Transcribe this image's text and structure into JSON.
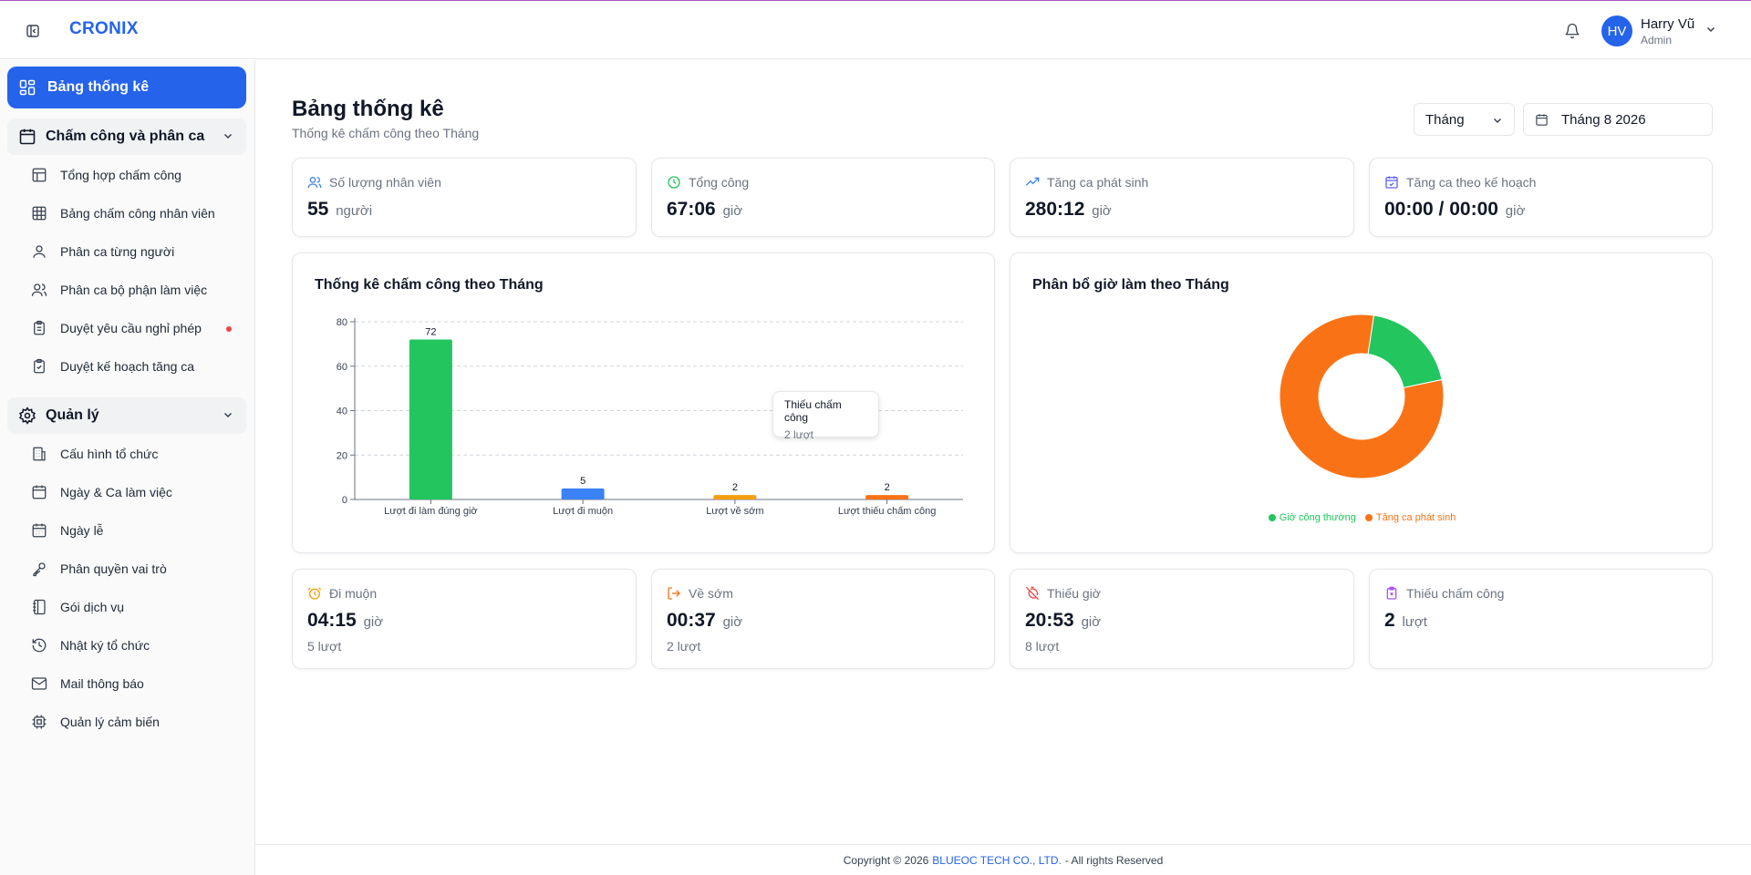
{
  "app": {
    "brand": "CRONIX"
  },
  "user": {
    "initials": "HV",
    "name": "Harry Vũ",
    "role": "Admin"
  },
  "sidebar": {
    "active": {
      "label": "Bảng thống kê"
    },
    "groups": [
      {
        "label": "Chấm công và phân ca",
        "items": [
          {
            "label": "Tổng hợp chấm công"
          },
          {
            "label": "Bảng chấm công nhân viên"
          },
          {
            "label": "Phân ca từng người"
          },
          {
            "label": "Phân ca bộ phận làm việc"
          },
          {
            "label": "Duyệt yêu cầu nghỉ phép",
            "has_notification": true
          },
          {
            "label": "Duyệt kế hoạch tăng ca"
          }
        ]
      },
      {
        "label": "Quản lý",
        "items": [
          {
            "label": "Cấu hình tổ chức"
          },
          {
            "label": "Ngày & Ca làm việc"
          },
          {
            "label": "Ngày lễ"
          },
          {
            "label": "Phân quyền vai trò"
          },
          {
            "label": "Gói dịch vụ"
          },
          {
            "label": "Nhật ký tổ chức"
          },
          {
            "label": "Mail thông báo"
          },
          {
            "label": "Quản lý cảm biến"
          }
        ]
      }
    ]
  },
  "page": {
    "title": "Bảng thống kê",
    "subtitle": "Thống kê chấm công theo Tháng",
    "period_select": "Tháng",
    "date_value": "Tháng 8 2026"
  },
  "stats_top": [
    {
      "label": "Số lượng nhân viên",
      "value": "55",
      "unit": "người",
      "icon": "users-icon",
      "color": "#3b82f6"
    },
    {
      "label": "Tổng công",
      "value": "67:06",
      "unit": "giờ",
      "icon": "clock-icon",
      "color": "#22c55e"
    },
    {
      "label": "Tăng ca phát sinh",
      "value": "280:12",
      "unit": "giờ",
      "icon": "trending-up-icon",
      "color": "#3b82f6"
    },
    {
      "label": "Tăng ca theo kế hoạch",
      "value": "00:00 / 00:00",
      "unit": "giờ",
      "icon": "calendar-check-icon",
      "color": "#6366f1"
    }
  ],
  "stats_bottom": [
    {
      "label": "Đi muộn",
      "value": "04:15",
      "unit": "giờ",
      "count": "5 lượt",
      "icon": "alarm-icon",
      "color": "#f59e0b"
    },
    {
      "label": "Về sớm",
      "value": "00:37",
      "unit": "giờ",
      "count": "2 lượt",
      "icon": "log-out-icon",
      "color": "#f97316"
    },
    {
      "label": "Thiếu giờ",
      "value": "20:53",
      "unit": "giờ",
      "count": "8 lượt",
      "icon": "timer-off-icon",
      "color": "#ef4444"
    },
    {
      "label": "Thiếu chấm công",
      "value": "2",
      "unit": "lượt",
      "count": "",
      "icon": "clipboard-x-icon",
      "color": "#a855f7"
    }
  ],
  "chart_data": [
    {
      "type": "bar",
      "title": "Thống kê chấm công theo Tháng",
      "categories": [
        "Lượt đi làm đúng giờ",
        "Lượt đi muộn",
        "Lượt về sớm",
        "Lượt thiếu chấm công"
      ],
      "values": [
        72,
        5,
        2,
        2
      ],
      "colors": [
        "#22c55e",
        "#3b82f6",
        "#f59e0b",
        "#f97316"
      ],
      "yticks": [
        0,
        20,
        40,
        60,
        80
      ],
      "ylim": [
        0,
        80
      ],
      "grid": true,
      "tooltip": {
        "title": "Thiếu chấm công",
        "value": "2 lượt"
      }
    },
    {
      "type": "pie",
      "title": "Phân bổ giờ làm theo Tháng",
      "labels": [
        "Giờ công thường",
        "Tăng ca phát sinh"
      ],
      "values": [
        67.1,
        280.2
      ],
      "colors": [
        "#22c55e",
        "#f97316"
      ],
      "legend": "bottom"
    }
  ],
  "footer": {
    "prefix": "Copyright © 2026",
    "company": "BLUEOC TECH CO., LTD.",
    "suffix": "- All rights Reserved"
  }
}
